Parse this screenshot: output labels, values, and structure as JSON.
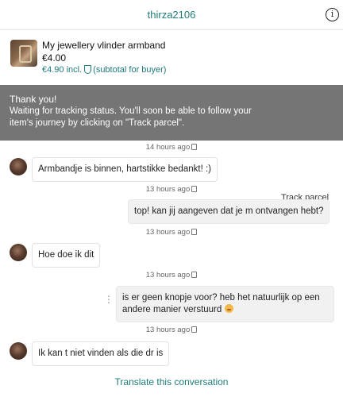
{
  "header": {
    "title": "thirza2106",
    "info_icon": "info-icon"
  },
  "item": {
    "title": "My jewellery vlinder armband",
    "price": "€4.00",
    "total": "€4.90 incl.",
    "protection_icon": "shield-icon",
    "total_note": "(subtotal for buyer)"
  },
  "banner": {
    "title": "Thank you!",
    "text": "Waiting for tracking status. You'll soon be able to follow your item's journey by clicking on \"Track parcel\".",
    "button": "Track parcel"
  },
  "messages": [
    {
      "time": "14 hours ago",
      "direction": "in",
      "text": "Armbandje is binnen, hartstikke bedankt! :)"
    },
    {
      "time": "13 hours ago",
      "direction": "out",
      "text": "top! kan jij aangeven dat je m ontvangen hebt?"
    },
    {
      "time": "13 hours ago",
      "direction": "in",
      "text": "Hoe doe ik dit"
    },
    {
      "time": "13 hours ago",
      "direction": "out",
      "text": "is er geen knopje voor? heb het natuurlijk op een andere manier verstuurd"
    },
    {
      "time": "13 hours ago",
      "direction": "in",
      "text": "Ik kan t niet vinden als die dr is"
    }
  ],
  "seen_icon": "seen-icon",
  "translate_link": "Translate this conversation",
  "colors": {
    "accent": "#1f7a7a",
    "banner_bg": "#757575"
  }
}
